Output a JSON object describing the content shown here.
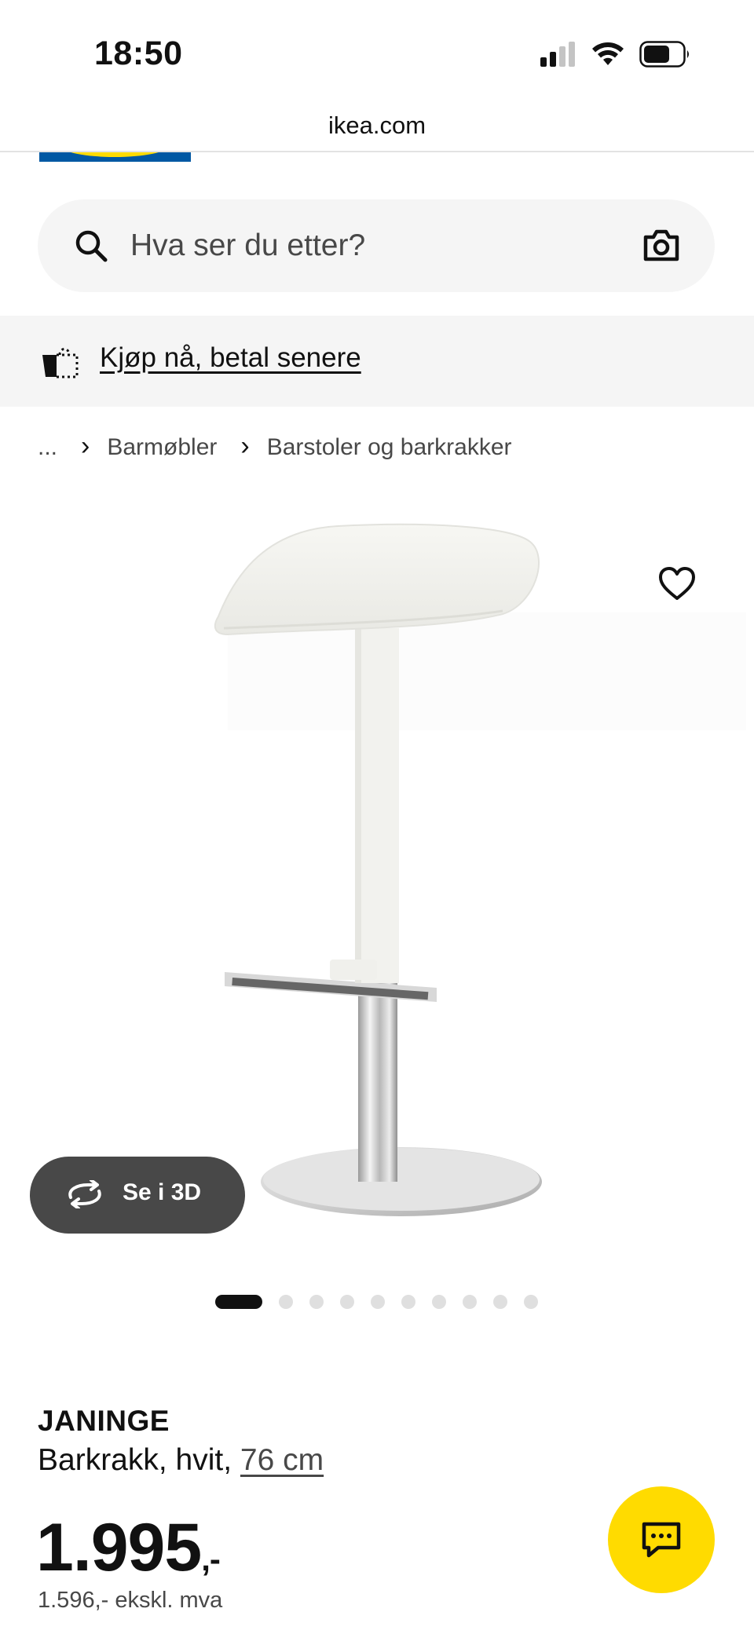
{
  "status_bar": {
    "time": "18:50"
  },
  "browser": {
    "url": "ikea.com"
  },
  "search": {
    "placeholder": "Hva ser du etter?"
  },
  "promo": {
    "link_text": "Kjøp nå, betal senere"
  },
  "breadcrumb": {
    "ellipsis": "...",
    "items": [
      "Barmøbler",
      "Barstoler og barkrakker"
    ]
  },
  "viewer": {
    "button_label": "Se i 3D",
    "image_count": 10,
    "active_index": 0
  },
  "product": {
    "name": "JANINGE",
    "description": "Barkrakk, hvit,",
    "size": "76 cm",
    "price": "1.995",
    "price_suffix": ",-",
    "price_ex_vat": "1.596,- ekskl. mva"
  },
  "colors": {
    "brand_blue": "#0058a3",
    "brand_yellow": "#ffdb00",
    "dark_grey": "#484848"
  }
}
